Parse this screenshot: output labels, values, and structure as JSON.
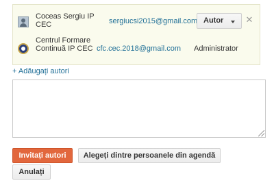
{
  "authors": [
    {
      "name": "Coceas Sergiu IP CEC",
      "email": "sergiucsi2015@gmail.com",
      "role": "Autor",
      "avatar_icon": "person-avatar-icon",
      "remove_icon": "close-icon"
    },
    {
      "name": "Centrul Formare Continuă IP CEC",
      "email": "cfc.cec.2018@gmail.com",
      "role": "Administrator",
      "avatar_icon": "org-logo-icon"
    }
  ],
  "remove_glyph": "✕",
  "add_authors_label": "+ Adăugați autori",
  "invite_input": {
    "value": ""
  },
  "buttons": {
    "invite": "Invitați autori",
    "choose_contacts": "Alegeți dintre persoanele din agendă",
    "cancel": "Anulați"
  },
  "colors": {
    "accent": "#e2673d",
    "link": "#1e6e96",
    "authors_background": "#fafbed"
  }
}
